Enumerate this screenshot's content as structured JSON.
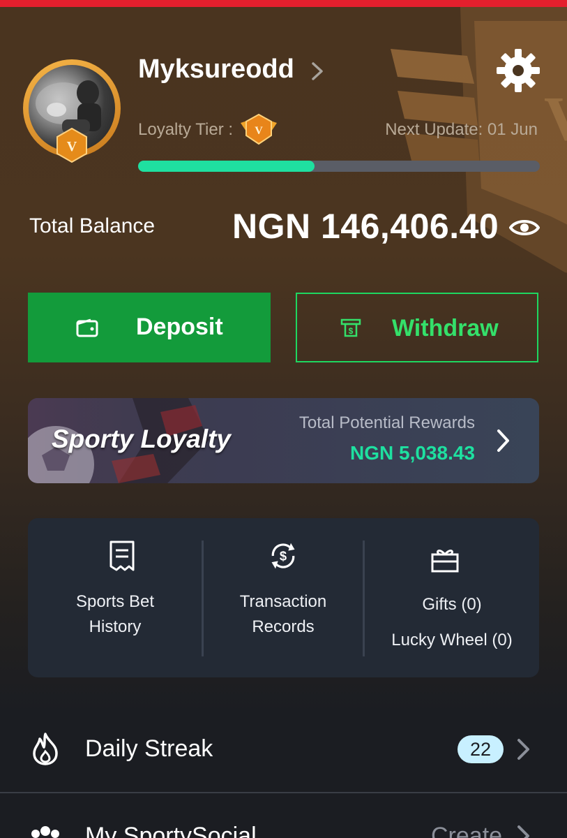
{
  "profile": {
    "username": "Myksureodd",
    "avatar_tier_letter": "V",
    "loyalty_tier_label": "Loyalty Tier :",
    "tier_badge_letter": "V",
    "next_update": "Next Update: 01 Jun",
    "tier_progress_percent": 44
  },
  "balance": {
    "label": "Total Balance",
    "value": "NGN 146,406.40"
  },
  "actions": {
    "deposit_label": "Deposit",
    "withdraw_label": "Withdraw",
    "withdraw_icon_glyph": "$"
  },
  "loyalty": {
    "title": "Sporty Loyalty",
    "rewards_label": "Total Potential Rewards",
    "rewards_value": "NGN 5,038.43"
  },
  "quick_links": {
    "bet_history_line1": "Sports Bet",
    "bet_history_line2": "History",
    "transactions_line1": "Transaction",
    "transactions_line2": "Records",
    "gifts": "Gifts (0)",
    "lucky_wheel": "Lucky Wheel (0)"
  },
  "menu": {
    "daily_streak_label": "Daily Streak",
    "daily_streak_count": "22",
    "social_label": "My SportySocial",
    "social_action": "Create"
  },
  "colors": {
    "accent_green": "#139b3b",
    "progress_green": "#1fe0a0",
    "top_bar_red": "#e41f2d"
  },
  "icons": [
    "settings-gear-icon",
    "chevron-right-icon",
    "eye-icon",
    "wallet-icon",
    "atm-cash-icon",
    "receipt-icon",
    "refresh-dollar-icon",
    "gift-icon",
    "flame-icon",
    "people-group-icon"
  ]
}
